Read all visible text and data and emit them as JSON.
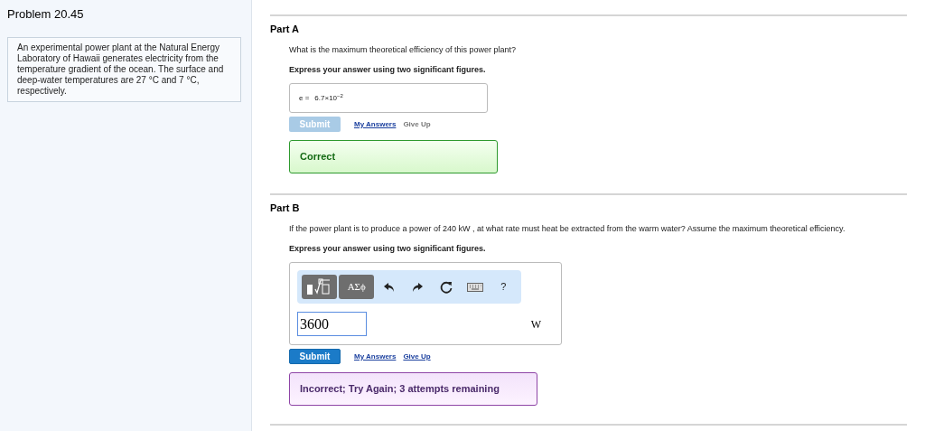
{
  "problem": {
    "title": "Problem 20.45",
    "statement": "An experimental power plant at the Natural Energy Laboratory of Hawaii generates electricity from the temperature gradient of the ocean. The surface and deep-water temperatures are 27 °C and 7 °C, respectively."
  },
  "parts": [
    {
      "label": "Part A",
      "question": "What is the maximum theoretical efficiency of this power plant?",
      "instruction": "Express your answer using two significant figures.",
      "answer": {
        "kind": "display",
        "variable": "e =",
        "value": "6.7×10$^{−2}$"
      },
      "submit": {
        "label": "Submit",
        "disabled": true
      },
      "my_answers": "My Answers",
      "give_up": {
        "label": "Give Up",
        "disabled": true
      },
      "feedback": {
        "kind": "correct",
        "text": "Correct"
      }
    },
    {
      "label": "Part B",
      "question": "If the power plant is to produce a power of 240 kW , at what rate must heat be extracted from the warm water? Assume the maximum theoretical efficiency.",
      "instruction": "Express your answer using two significant figures.",
      "answer": {
        "kind": "editor",
        "toolbar": [
          {
            "kind": "templates"
          },
          {
            "kind": "text",
            "label": "ΑΣϕ"
          },
          {
            "kind": "undo"
          },
          {
            "kind": "redo"
          },
          {
            "kind": "reset"
          },
          {
            "kind": "keyboard"
          },
          {
            "kind": "plain",
            "label": "?"
          }
        ],
        "value": "3600",
        "unit": "W"
      },
      "submit": {
        "label": "Submit",
        "disabled": false
      },
      "my_answers": "My Answers",
      "give_up": {
        "label": "Give Up",
        "disabled": false
      },
      "feedback": {
        "kind": "incorrect",
        "text": "Incorrect; Try Again; 3 attempts remaining"
      }
    }
  ]
}
